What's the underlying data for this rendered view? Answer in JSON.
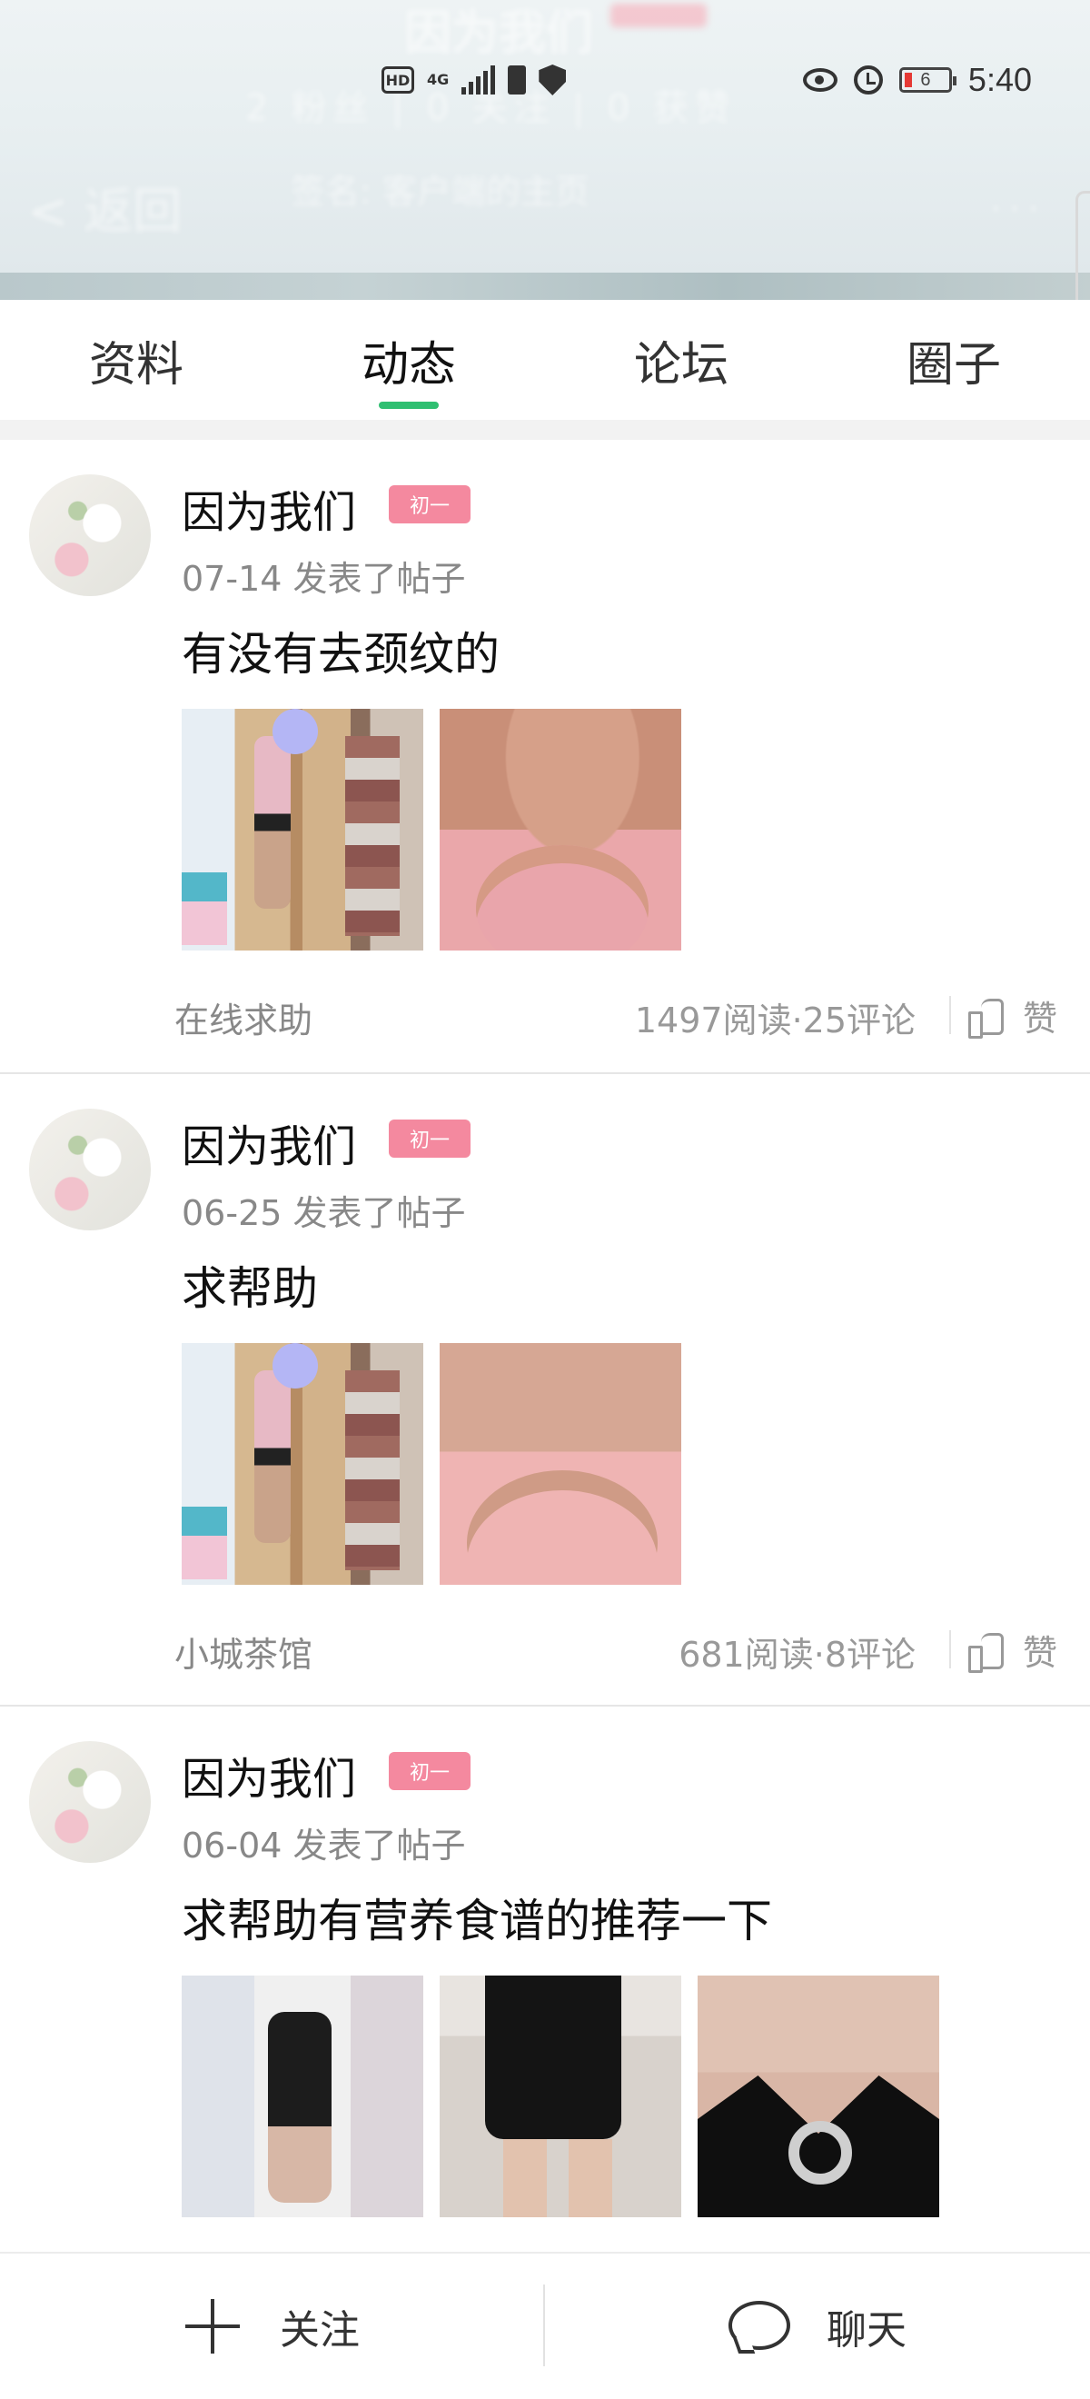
{
  "header": {
    "profile_name": "因为我们",
    "stats_text": "2 粉丝 | 0 关注 | 0 获赞",
    "back_label": "< 返回",
    "intro_text": "签名: 客户端的主页",
    "more_label": "...",
    "accent_color": "#2fbf71"
  },
  "status_bar": {
    "hd": "HD",
    "network": "4G",
    "battery_level": "6",
    "time": "5:40"
  },
  "tabs": [
    {
      "label": "资料",
      "active": false
    },
    {
      "label": "动态",
      "active": true
    },
    {
      "label": "论坛",
      "active": false
    },
    {
      "label": "圈子",
      "active": false
    }
  ],
  "posts": [
    {
      "author": "因为我们",
      "badge": "初一",
      "date": "07-14",
      "action": "发表了帖子",
      "title": "有没有去颈纹的",
      "images": [
        "mirror-photo",
        "neck-photo"
      ],
      "forum": "在线求助",
      "stats": "1497阅读·25评论",
      "like_label": "赞"
    },
    {
      "author": "因为我们",
      "badge": "初一",
      "date": "06-25",
      "action": "发表了帖子",
      "title": "求帮助",
      "images": [
        "mirror-photo",
        "neck-photo"
      ],
      "forum": "小城茶馆",
      "stats": "681阅读·8评论",
      "like_label": "赞"
    },
    {
      "author": "因为我们",
      "badge": "初一",
      "date": "06-04",
      "action": "发表了帖子",
      "title": "求帮助有营养食谱的推荐一下",
      "images": [
        "mirror-photo",
        "legs-photo",
        "neckline-photo"
      ]
    }
  ],
  "bottom_bar": {
    "follow_label": "关注",
    "chat_label": "聊天"
  }
}
